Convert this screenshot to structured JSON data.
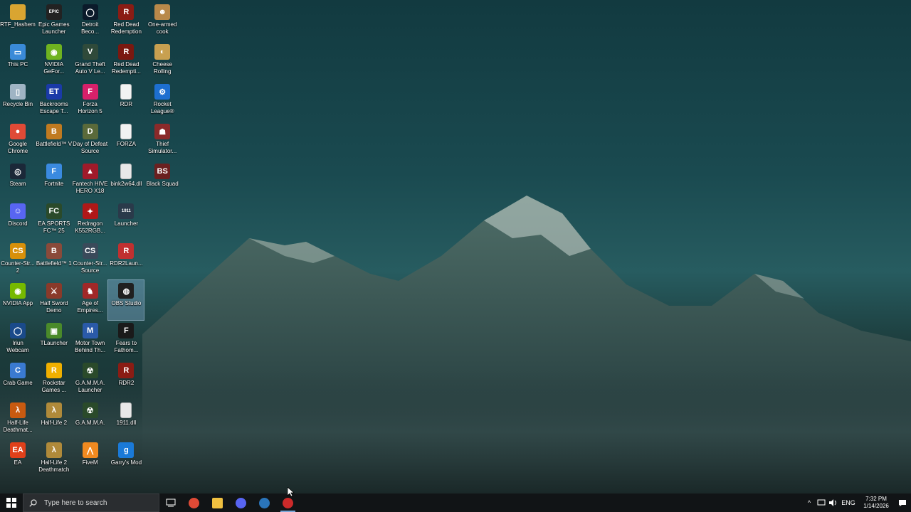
{
  "desktop": {
    "icons": [
      {
        "label": "RTF_Hashem",
        "icon": "folder-icon",
        "color": "#d9a531",
        "glyph": "",
        "col": 0,
        "row": 0
      },
      {
        "label": "Epic Games\nLauncher",
        "icon": "epic-games-icon",
        "color": "#222222",
        "glyph": "EPIC",
        "col": 1,
        "row": 0
      },
      {
        "label": "Detroit\nBeco...",
        "icon": "detroit-icon",
        "color": "#0b1a2a",
        "glyph": "◯",
        "col": 2,
        "row": 0
      },
      {
        "label": "Red Dead\nRedemption",
        "icon": "rdr-icon",
        "color": "#8a1c14",
        "glyph": "R",
        "col": 3,
        "row": 0
      },
      {
        "label": "One-armed\ncook",
        "icon": "one-armed-cook-icon",
        "color": "#b8894a",
        "glyph": "☻",
        "col": 4,
        "row": 0
      },
      {
        "label": "This PC",
        "icon": "monitor-icon",
        "color": "#3a8ad8",
        "glyph": "▭",
        "col": 0,
        "row": 1
      },
      {
        "label": "NVIDIA\nGeFor...",
        "icon": "nvidia-icon",
        "color": "#6fb320",
        "glyph": "◉",
        "col": 1,
        "row": 1
      },
      {
        "label": "Grand Theft\nAuto V Le...",
        "icon": "gta-v-icon",
        "color": "#2f4a3a",
        "glyph": "V",
        "col": 2,
        "row": 1
      },
      {
        "label": "Red Dead\nRedempti...",
        "icon": "rdr2-icon",
        "color": "#7a1810",
        "glyph": "R",
        "col": 3,
        "row": 1
      },
      {
        "label": "Cheese\nRolling",
        "icon": "cheese-rolling-icon",
        "color": "#c8a050",
        "glyph": "◐",
        "col": 4,
        "row": 1
      },
      {
        "label": "Recycle Bin",
        "icon": "recycle-bin-icon",
        "color": "#9fb4c4",
        "glyph": "▯",
        "col": 0,
        "row": 2
      },
      {
        "label": "Backrooms\nEscape T...",
        "icon": "backrooms-icon",
        "color": "#1a3aa8",
        "glyph": "ET",
        "col": 1,
        "row": 2
      },
      {
        "label": "Forza\nHorizon 5",
        "icon": "forza-icon",
        "color": "#d8206a",
        "glyph": "F",
        "col": 2,
        "row": 2
      },
      {
        "label": "RDR",
        "icon": "document-icon",
        "color": "#f2f2f2",
        "glyph": "",
        "col": 3,
        "row": 2
      },
      {
        "label": "Rocket\nLeague®",
        "icon": "rocket-league-icon",
        "color": "#1d6fd0",
        "glyph": "⚙",
        "col": 4,
        "row": 2
      },
      {
        "label": "Google\nChrome",
        "icon": "chrome-icon",
        "color": "#e04a36",
        "glyph": "●",
        "col": 0,
        "row": 3
      },
      {
        "label": "Battlefield™ V",
        "icon": "battlefield-v-icon",
        "color": "#c07a20",
        "glyph": "B",
        "col": 1,
        "row": 3
      },
      {
        "label": "Day of Defeat\nSource",
        "icon": "dod-icon",
        "color": "#5a6a3a",
        "glyph": "D",
        "col": 2,
        "row": 3
      },
      {
        "label": "FORZA",
        "icon": "document-icon",
        "color": "#f2f2f2",
        "glyph": "",
        "col": 3,
        "row": 3
      },
      {
        "label": "Thief\nSimulator...",
        "icon": "thief-simulator-icon",
        "color": "#8a2a2a",
        "glyph": "☗",
        "col": 4,
        "row": 3
      },
      {
        "label": "Steam",
        "icon": "steam-icon",
        "color": "#1b2838",
        "glyph": "◎",
        "col": 0,
        "row": 4
      },
      {
        "label": "Fortnite",
        "icon": "fortnite-icon",
        "color": "#3a8ae0",
        "glyph": "F",
        "col": 1,
        "row": 4
      },
      {
        "label": "Fantech HIVE\nHERO X18",
        "icon": "fantech-icon",
        "color": "#a01a2a",
        "glyph": "▲",
        "col": 2,
        "row": 4
      },
      {
        "label": "bink2w64.dll",
        "icon": "dll-file-icon",
        "color": "#e8e8e8",
        "glyph": "",
        "col": 3,
        "row": 4
      },
      {
        "label": "Black Squad",
        "icon": "black-squad-icon",
        "color": "#6a2020",
        "glyph": "BS",
        "col": 4,
        "row": 4
      },
      {
        "label": "Discord",
        "icon": "discord-icon",
        "color": "#5865f2",
        "glyph": "☺",
        "col": 0,
        "row": 5
      },
      {
        "label": "EA SPORTS\nFC™ 25",
        "icon": "ea-fc-icon",
        "color": "#2a4a2a",
        "glyph": "FC",
        "col": 1,
        "row": 5
      },
      {
        "label": "Redragon\nK552RGB...",
        "icon": "redragon-icon",
        "color": "#b01818",
        "glyph": "✦",
        "col": 2,
        "row": 5
      },
      {
        "label": "Launcher",
        "icon": "launcher-1911-icon",
        "color": "#2a3a4a",
        "glyph": "1911",
        "col": 3,
        "row": 5
      },
      {
        "label": "Counter-Str...\n2",
        "icon": "cs2-icon",
        "color": "#d8900a",
        "glyph": "CS",
        "col": 0,
        "row": 6
      },
      {
        "label": "Battlefield™ 1",
        "icon": "battlefield-1-icon",
        "color": "#8a4a3a",
        "glyph": "B",
        "col": 1,
        "row": 6
      },
      {
        "label": "Counter-Str...\nSource",
        "icon": "css-icon",
        "color": "#3a4a5a",
        "glyph": "CS",
        "col": 2,
        "row": 6
      },
      {
        "label": "RDR2Laun...",
        "icon": "rdr2-launcher-icon",
        "color": "#c03030",
        "glyph": "R",
        "col": 3,
        "row": 6
      },
      {
        "label": "NVIDIA App",
        "icon": "nvidia-app-icon",
        "color": "#76b900",
        "glyph": "◉",
        "col": 0,
        "row": 7
      },
      {
        "label": "Half Sword\nDemo",
        "icon": "half-sword-icon",
        "color": "#8a3a2a",
        "glyph": "⚔",
        "col": 1,
        "row": 7
      },
      {
        "label": "Age of\nEmpires...",
        "icon": "age-of-empires-icon",
        "color": "#a02828",
        "glyph": "♞",
        "col": 2,
        "row": 7
      },
      {
        "label": "OBS Studio",
        "icon": "obs-icon",
        "color": "#202020",
        "glyph": "◍",
        "col": 3,
        "row": 7,
        "selected": true
      },
      {
        "label": "Iriun\nWebcam",
        "icon": "iriun-webcam-icon",
        "color": "#1a4a8a",
        "glyph": "◯",
        "col": 0,
        "row": 8
      },
      {
        "label": "TLauncher",
        "icon": "tlauncher-icon",
        "color": "#4a8a2a",
        "glyph": "▣",
        "col": 1,
        "row": 8
      },
      {
        "label": "Motor Town\nBehind Th...",
        "icon": "motor-town-icon",
        "color": "#2a5aa8",
        "glyph": "M",
        "col": 2,
        "row": 8
      },
      {
        "label": "Fears to\nFathom...",
        "icon": "fears-to-fathom-icon",
        "color": "#1a1a1a",
        "glyph": "F",
        "col": 3,
        "row": 8
      },
      {
        "label": "Crab Game",
        "icon": "crab-game-icon",
        "color": "#3a7ad0",
        "glyph": "C",
        "col": 0,
        "row": 9
      },
      {
        "label": "Rockstar\nGames ...",
        "icon": "rockstar-icon",
        "color": "#f0b000",
        "glyph": "R",
        "col": 1,
        "row": 9
      },
      {
        "label": "G.A.M.M.A.\nLauncher",
        "icon": "gamma-launcher-icon",
        "color": "#2a4a2a",
        "glyph": "☢",
        "col": 2,
        "row": 9
      },
      {
        "label": "RDR2",
        "icon": "rdr2-shortcut-icon",
        "color": "#8a1c14",
        "glyph": "R",
        "col": 3,
        "row": 9
      },
      {
        "label": "Half-Life\nDeathmat...",
        "icon": "half-life-dm-icon",
        "color": "#c85a10",
        "glyph": "λ",
        "col": 0,
        "row": 10
      },
      {
        "label": "Half-Life 2",
        "icon": "half-life-2-icon",
        "color": "#b08a3a",
        "glyph": "λ",
        "col": 1,
        "row": 10
      },
      {
        "label": "G.A.M.M.A.",
        "icon": "gamma-icon",
        "color": "#2a4a2a",
        "glyph": "☢",
        "col": 2,
        "row": 10
      },
      {
        "label": "1911.dll",
        "icon": "dll-file-icon",
        "color": "#e8e8e8",
        "glyph": "",
        "col": 3,
        "row": 10
      },
      {
        "label": "EA",
        "icon": "ea-icon",
        "color": "#e0401a",
        "glyph": "EA",
        "col": 0,
        "row": 11
      },
      {
        "label": "Half-Life 2\nDeathmatch",
        "icon": "half-life-2-dm-icon",
        "color": "#b08a3a",
        "glyph": "λ",
        "col": 1,
        "row": 11
      },
      {
        "label": "FiveM",
        "icon": "fivem-icon",
        "color": "#f08a20",
        "glyph": "⋀",
        "col": 2,
        "row": 11
      },
      {
        "label": "Garry's Mod",
        "icon": "garrys-mod-icon",
        "color": "#1a7ad8",
        "glyph": "g",
        "col": 3,
        "row": 11
      }
    ]
  },
  "taskbar": {
    "search_placeholder": "Type here to search",
    "apps": [
      {
        "name": "chrome-taskbar-icon",
        "color": "#e04a36",
        "active": false
      },
      {
        "name": "file-explorer-taskbar-icon",
        "color": "#f0c040",
        "active": false
      },
      {
        "name": "discord-taskbar-icon",
        "color": "#5865f2",
        "active": false
      },
      {
        "name": "steam-taskbar-icon",
        "color": "#2a75bb",
        "active": false
      },
      {
        "name": "obs-taskbar-icon",
        "color": "#cc2a2a",
        "active": true
      }
    ],
    "tray": {
      "language": "ENG",
      "time": "7:32 PM",
      "date": "1/14/2026"
    }
  }
}
